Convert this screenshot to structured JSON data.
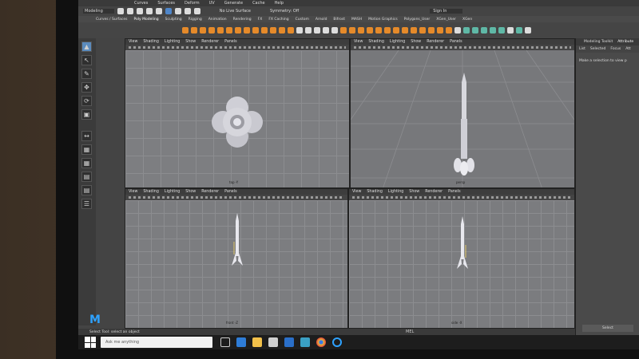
{
  "menubar": {
    "items": [
      "Curves",
      "Surfaces",
      "Deform",
      "UV",
      "Generate",
      "Cache",
      "Help"
    ]
  },
  "statusline": {
    "mode": "Modeling",
    "live_surface": "No Live Surface",
    "symmetry": "Symmetry: Off",
    "sign_in": "Sign In"
  },
  "shelf_tabs": [
    "Curves / Surfaces",
    "Poly Modeling",
    "Sculpting",
    "Rigging",
    "Animation",
    "Rendering",
    "FX",
    "FX Caching",
    "Custom",
    "Arnold",
    "Bifrost",
    "MASH",
    "Motion Graphics",
    "Polygons_User",
    "XGen_User",
    "XGen"
  ],
  "viewport_menu": [
    "View",
    "Shading",
    "Lighting",
    "Show",
    "Renderer",
    "Panels"
  ],
  "viewports": [
    {
      "label": "top -Y"
    },
    {
      "label": "persp"
    },
    {
      "label": "front -Z"
    },
    {
      "label": "side -X"
    }
  ],
  "right_panel": {
    "tabs": [
      "Modeling Toolkit",
      "Attribute"
    ],
    "menu": [
      "List",
      "Selected",
      "Focus",
      "Att"
    ],
    "message": "Make a selection to view p"
  },
  "help_line": "Select Tool: select an object",
  "command_label": "MEL",
  "right_button": "Select",
  "taskbar": {
    "search_placeholder": "Ask me anything"
  },
  "logo": "M",
  "colors": {
    "accent": "#e58a2a",
    "selection": "#5b8bbd",
    "maya_blue": "#2ea2ff"
  }
}
